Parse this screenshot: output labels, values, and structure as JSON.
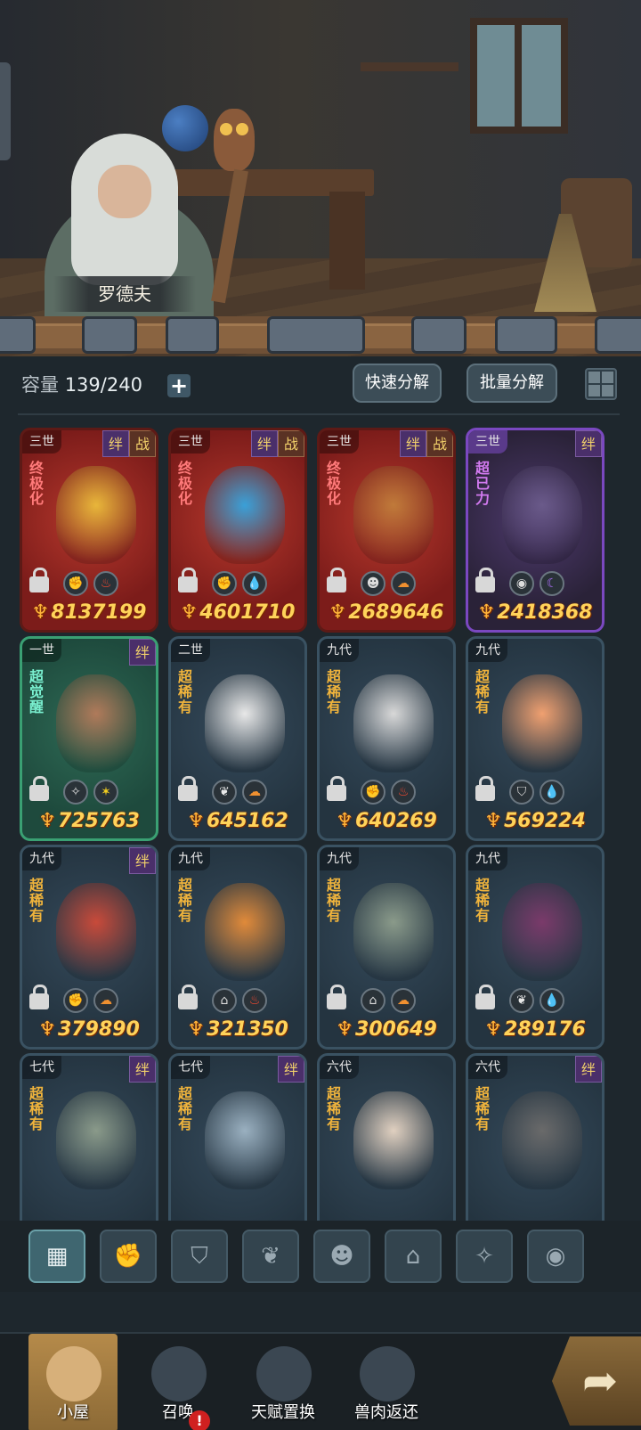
{
  "npc": {
    "name": "罗德夫"
  },
  "header": {
    "capacity_label": "容量",
    "capacity_value": "139/240",
    "add_icon": "plus-icon",
    "quick_decompose": "快速分解",
    "batch_decompose": "批量分解",
    "grid_icon": "grid-view-icon"
  },
  "cards": [
    {
      "gen": "三世",
      "tags": [
        "绊",
        "战"
      ],
      "rarity": "终极化",
      "elements": [
        "fist-icon",
        "fire-icon"
      ],
      "power": "8137199",
      "style": "red"
    },
    {
      "gen": "三世",
      "tags": [
        "绊",
        "战"
      ],
      "rarity": "终极化",
      "elements": [
        "fist-icon",
        "water-icon"
      ],
      "power": "4601710",
      "style": "red"
    },
    {
      "gen": "三世",
      "tags": [
        "绊",
        "战"
      ],
      "rarity": "终极化",
      "elements": [
        "alien-icon",
        "earth-icon"
      ],
      "power": "2689646",
      "style": "red"
    },
    {
      "gen": "三世",
      "tags": [
        "绊"
      ],
      "rarity": "超已力",
      "elements": [
        "eye-icon",
        "moon-icon"
      ],
      "power": "2418368",
      "style": "purple"
    },
    {
      "gen": "一世",
      "tags": [
        "绊"
      ],
      "rarity": "超觉醒",
      "elements": [
        "compass-icon",
        "star-icon"
      ],
      "power": "725763",
      "style": "green"
    },
    {
      "gen": "二世",
      "tags": [],
      "rarity": "超稀有",
      "elements": [
        "leaf-icon",
        "earth-icon"
      ],
      "power": "645162",
      "style": "blue"
    },
    {
      "gen": "九代",
      "tags": [],
      "rarity": "超稀有",
      "elements": [
        "fist-icon",
        "fire-icon"
      ],
      "power": "640269",
      "style": "blue"
    },
    {
      "gen": "九代",
      "tags": [],
      "rarity": "超稀有",
      "elements": [
        "shield-icon",
        "water-icon"
      ],
      "power": "569224",
      "style": "blue"
    },
    {
      "gen": "九代",
      "tags": [
        "绊"
      ],
      "rarity": "超稀有",
      "elements": [
        "fist-icon",
        "earth-icon"
      ],
      "power": "379890",
      "style": "blue"
    },
    {
      "gen": "九代",
      "tags": [],
      "rarity": "超稀有",
      "elements": [
        "house-icon",
        "fire-icon"
      ],
      "power": "321350",
      "style": "blue"
    },
    {
      "gen": "九代",
      "tags": [],
      "rarity": "超稀有",
      "elements": [
        "house-icon",
        "earth-icon"
      ],
      "power": "300649",
      "style": "blue"
    },
    {
      "gen": "九代",
      "tags": [],
      "rarity": "超稀有",
      "elements": [
        "leaf-icon",
        "water-icon"
      ],
      "power": "289176",
      "style": "blue"
    },
    {
      "gen": "七代",
      "tags": [
        "绊"
      ],
      "rarity": "超稀有",
      "elements": [],
      "power": "",
      "style": "blue"
    },
    {
      "gen": "七代",
      "tags": [
        "绊"
      ],
      "rarity": "超稀有",
      "elements": [],
      "power": "",
      "style": "blue"
    },
    {
      "gen": "六代",
      "tags": [],
      "rarity": "超稀有",
      "elements": [],
      "power": "",
      "style": "blue"
    },
    {
      "gen": "六代",
      "tags": [
        "绊"
      ],
      "rarity": "超稀有",
      "elements": [],
      "power": "",
      "style": "blue"
    }
  ],
  "filters": [
    "all-icon",
    "fist-icon",
    "shield-icon",
    "leaf-icon",
    "alien-icon",
    "house-icon",
    "compass-icon",
    "eye-icon"
  ],
  "nav": [
    {
      "label": "小屋",
      "icon": "hut-icon",
      "active": true
    },
    {
      "label": "召唤",
      "icon": "egg-icon",
      "badge": "!"
    },
    {
      "label": "天赋置换",
      "icon": "fist-icon"
    },
    {
      "label": "兽肉返还",
      "icon": "meat-icon"
    }
  ],
  "back_icon": "back-arrow-icon"
}
